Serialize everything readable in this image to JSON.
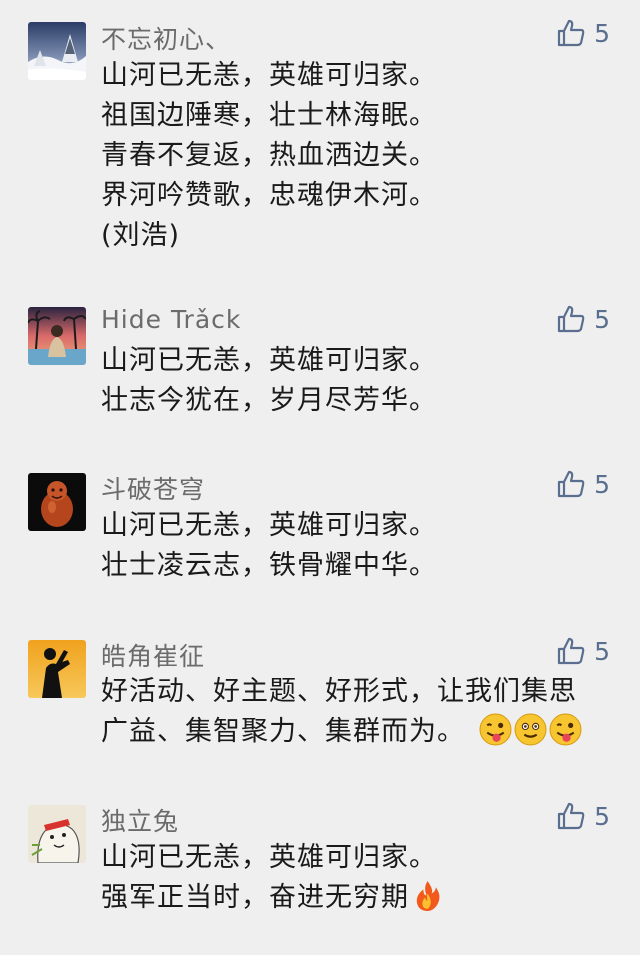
{
  "comments": [
    {
      "name": "不忘初心、",
      "likes": "5",
      "lines": [
        "山河已无恙，英雄可归家。",
        "祖国边陲寒，壮士林海眠。",
        "青春不复返，热血洒边关。",
        "界河吟赞歌，忠魂伊木河。",
        "(刘浩)"
      ]
    },
    {
      "name": "Hide Trǎck",
      "likes": "5",
      "lines": [
        "山河已无恙，英雄可归家。",
        "壮志今犹在，岁月尽芳华。"
      ]
    },
    {
      "name": "斗破苍穹",
      "likes": "5",
      "lines": [
        "山河已无恙，英雄可归家。",
        "壮士凌云志，铁骨耀中华。"
      ]
    },
    {
      "name": "皓角崔征",
      "likes": "5",
      "lines": [
        "好活动、好主题、好形式，让我们集思",
        "广益、集智聚力、集群而为。"
      ],
      "emojis": [
        "winking-tongue-emoji",
        "smiling-emoji",
        "winking-tongue-emoji"
      ]
    },
    {
      "name": "独立兔",
      "likes": "5",
      "lines": [
        "山河已无恙，英雄可归家。",
        "强军正当时，奋进无穷期"
      ],
      "emojis": [
        "fire-emoji"
      ]
    }
  ],
  "colors": {
    "background": "#efefef",
    "name": "#6b6b6b",
    "text": "#1a1a1a",
    "like": "#5a6e8f"
  }
}
